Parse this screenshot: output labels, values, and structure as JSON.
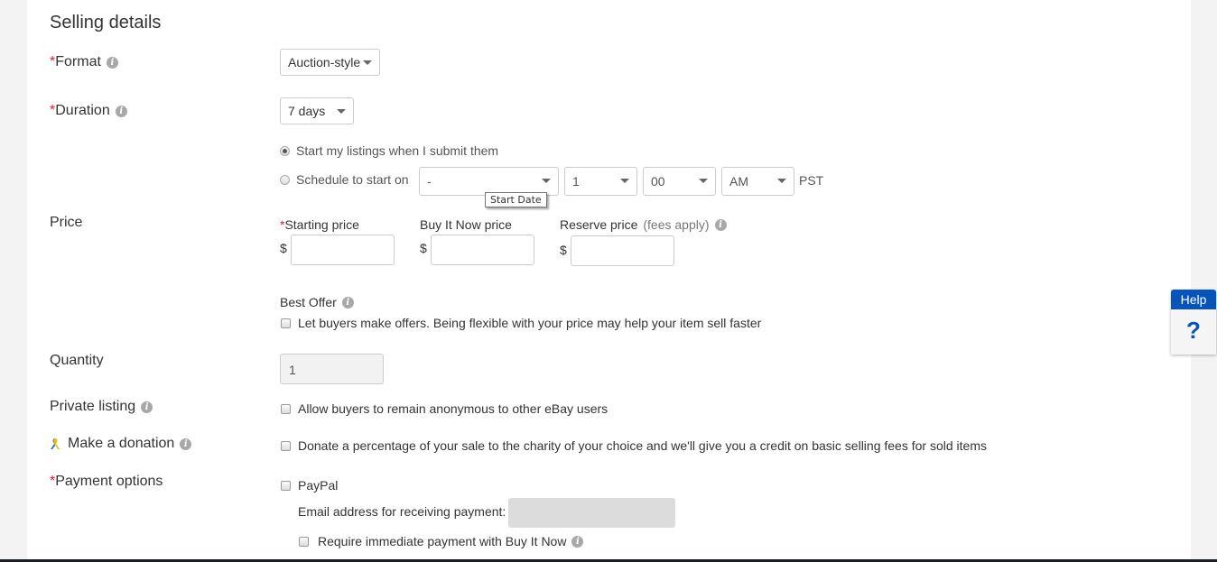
{
  "section_title": "Selling details",
  "format": {
    "label": "Format",
    "value": "Auction-style"
  },
  "duration": {
    "label": "Duration",
    "value": "7 days"
  },
  "start_options": {
    "immediate_label": "Start my listings when I submit them",
    "immediate_selected": true,
    "schedule_label": "Schedule to start on",
    "date_value": "-",
    "date_tooltip": "Start Date",
    "hour_value": "1",
    "minute_value": "00",
    "ampm_value": "AM",
    "timezone": "PST"
  },
  "price": {
    "label": "Price",
    "starting_label": "Starting price",
    "bin_label": "Buy It Now price",
    "reserve_label": "Reserve price",
    "reserve_note": "(fees apply)",
    "currency": "$",
    "starting_value": "",
    "bin_value": "",
    "reserve_value": ""
  },
  "best_offer": {
    "label": "Best Offer",
    "checkbox_label": "Let buyers make offers. Being flexible with your price may help your item sell faster",
    "checked": false
  },
  "quantity": {
    "label": "Quantity",
    "value": "1"
  },
  "private_listing": {
    "label": "Private listing",
    "checkbox_label": "Allow buyers to remain anonymous to other eBay users",
    "checked": false
  },
  "donation": {
    "label": "Make a donation",
    "checkbox_label": "Donate a percentage of your sale to the charity of your choice and we'll give you a credit on basic selling fees for sold items",
    "checked": false
  },
  "payment": {
    "label": "Payment options",
    "paypal_label": "PayPal",
    "email_label": "Email address for receiving payment:",
    "email_value": "",
    "immediate_label": "Require immediate payment with Buy It Now"
  },
  "help": {
    "label": "Help",
    "icon": "?"
  },
  "required_marker": "*",
  "info_icon": "i",
  "colors": {
    "required": "#dd1e31",
    "help_blue": "#0654ba"
  }
}
